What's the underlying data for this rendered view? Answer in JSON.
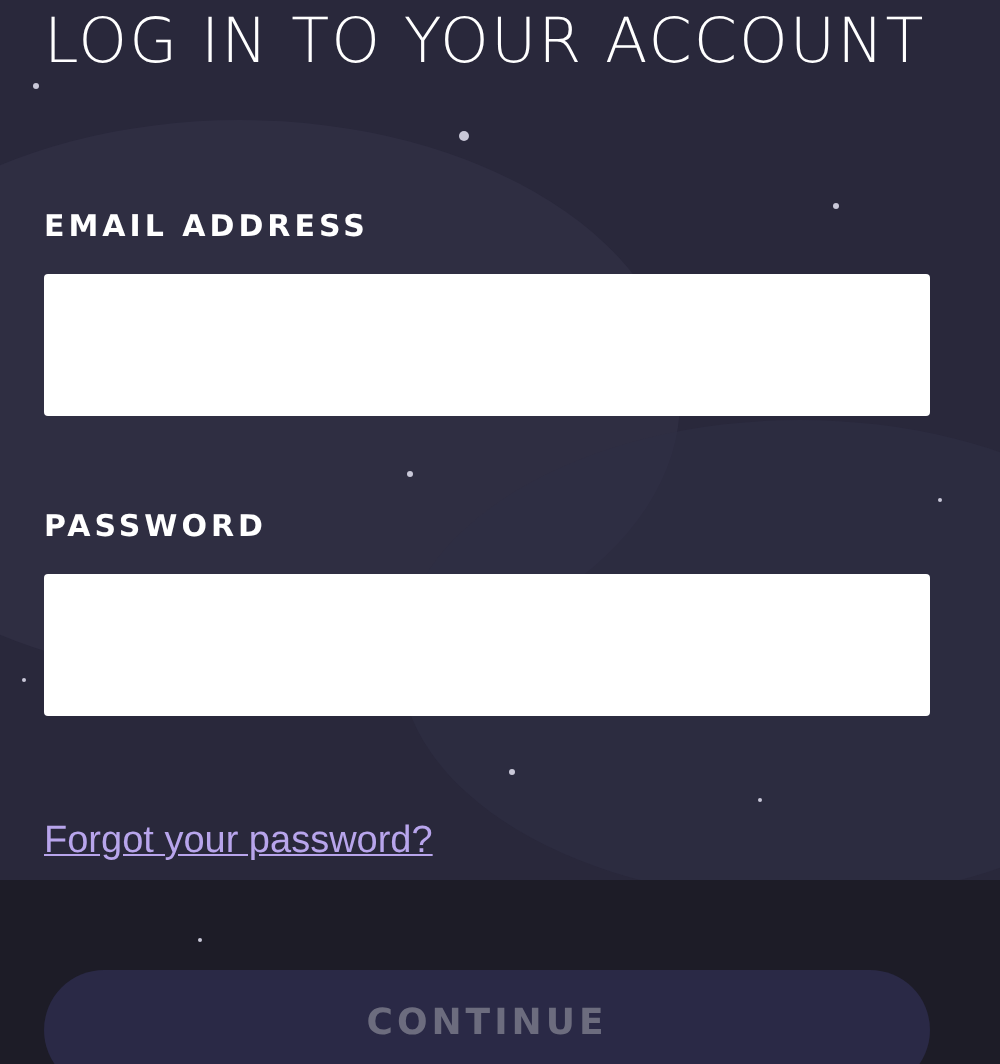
{
  "title": "LOG IN TO YOUR ACCOUNT",
  "fields": [
    {
      "label": "EMAIL ADDRESS"
    },
    {
      "label": "PASSWORD"
    }
  ],
  "forgot_link": "Forgot your password?",
  "continue_button": {
    "label": "CONTINUE",
    "disabled": true
  }
}
